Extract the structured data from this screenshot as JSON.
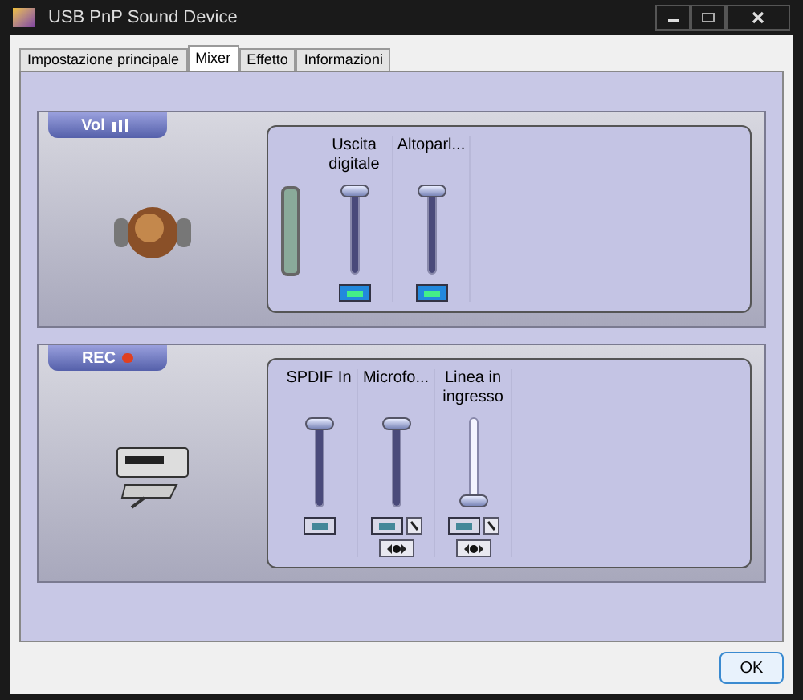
{
  "window": {
    "title": "USB PnP Sound Device"
  },
  "tabs": [
    {
      "label": "Impostazione principale",
      "selected": false
    },
    {
      "label": "Mixer",
      "selected": true
    },
    {
      "label": "Effetto",
      "selected": false
    },
    {
      "label": "Informazioni",
      "selected": false
    }
  ],
  "sections": [
    {
      "kind": "playback",
      "label": "Vol",
      "channels": [
        {
          "name": "Uscita digitale",
          "level": 1,
          "active": true,
          "advanced": false,
          "select": false
        },
        {
          "name": "Altoparl...",
          "level": 1,
          "active": true,
          "advanced": false,
          "select": false
        }
      ]
    },
    {
      "kind": "record",
      "label": "REC",
      "channels": [
        {
          "name": "SPDIF In",
          "level": 1,
          "active": false,
          "advanced": false,
          "select": false
        },
        {
          "name": "Microfo...",
          "level": 1,
          "active": false,
          "advanced": true,
          "select": true
        },
        {
          "name": "Linea in ingresso",
          "level": 0,
          "active": false,
          "advanced": true,
          "select": true
        }
      ]
    }
  ],
  "buttons": [
    {
      "label": "OK"
    }
  ]
}
